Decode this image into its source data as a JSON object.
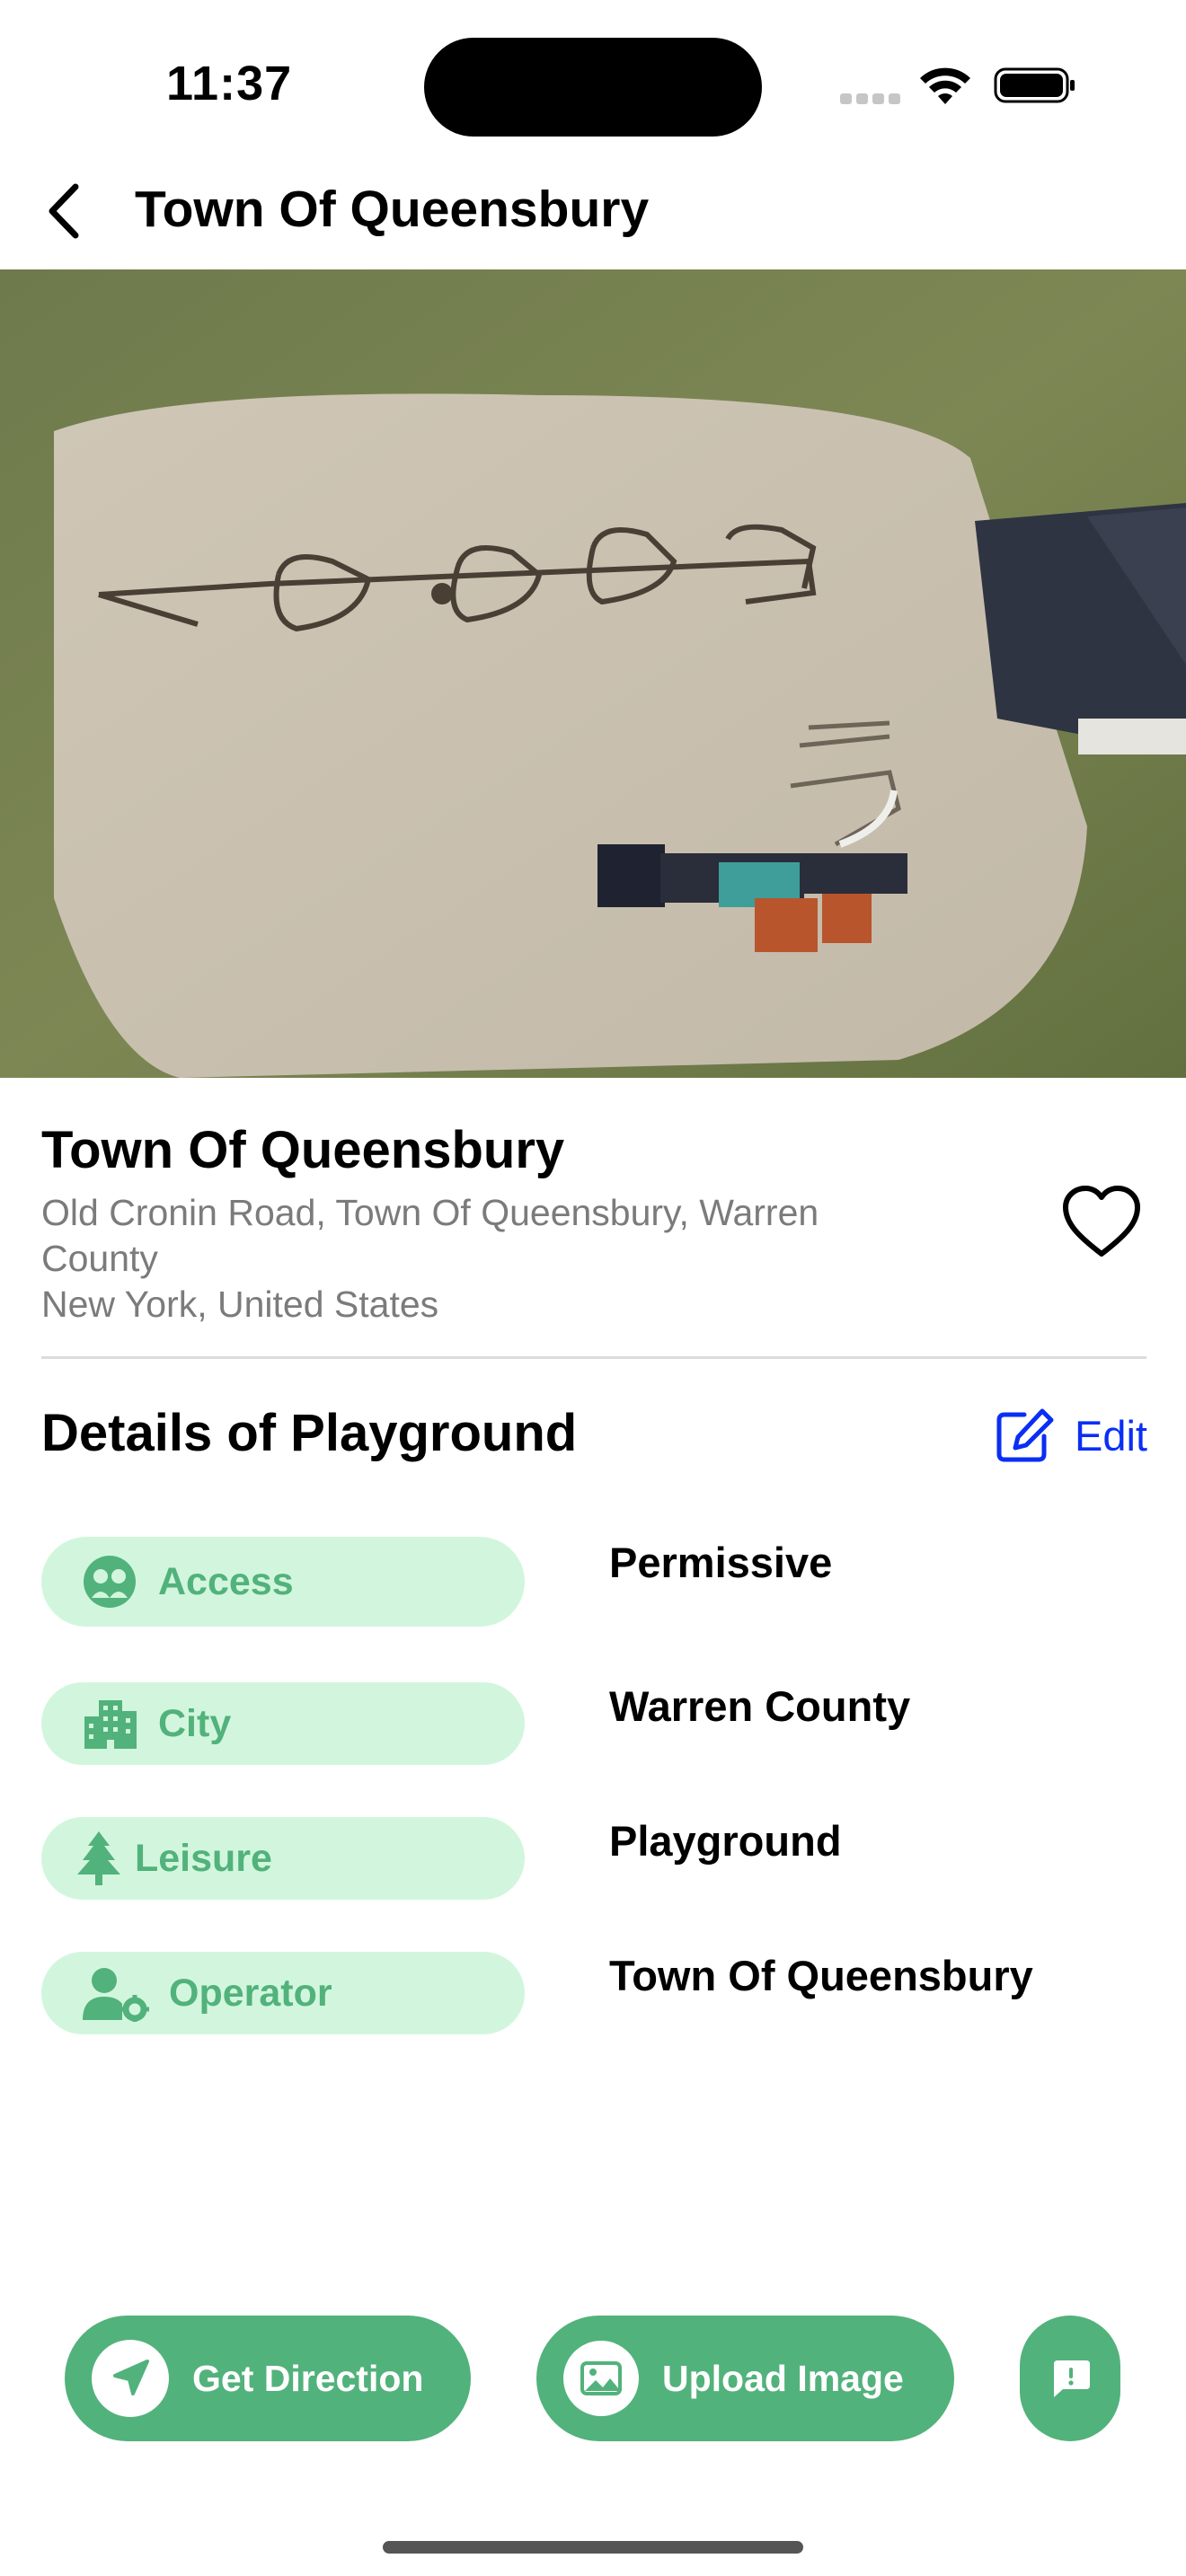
{
  "status_bar": {
    "time": "11:37"
  },
  "nav": {
    "title": "Town Of Queensbury"
  },
  "place": {
    "title": "Town Of Queensbury",
    "address_line1": "Old Cronin Road, Town Of Queensbury, Warren County",
    "address_line2": "New York, United States"
  },
  "details": {
    "title": "Details of Playground",
    "edit_label": "Edit",
    "rows": [
      {
        "label": "Access",
        "value": "Permissive",
        "icon": "access-icon"
      },
      {
        "label": "City",
        "value": "Warren County",
        "icon": "city-icon"
      },
      {
        "label": "Leisure",
        "value": "Playground",
        "icon": "tree-icon"
      },
      {
        "label": "Operator",
        "value": "Town Of Queensbury",
        "icon": "operator-icon"
      }
    ]
  },
  "actions": {
    "direction_label": "Get Direction",
    "upload_label": "Upload Image"
  },
  "colors": {
    "accent": "#52b27b",
    "chip_bg": "#d2f6dd",
    "edit_blue": "#0a2ef5"
  }
}
